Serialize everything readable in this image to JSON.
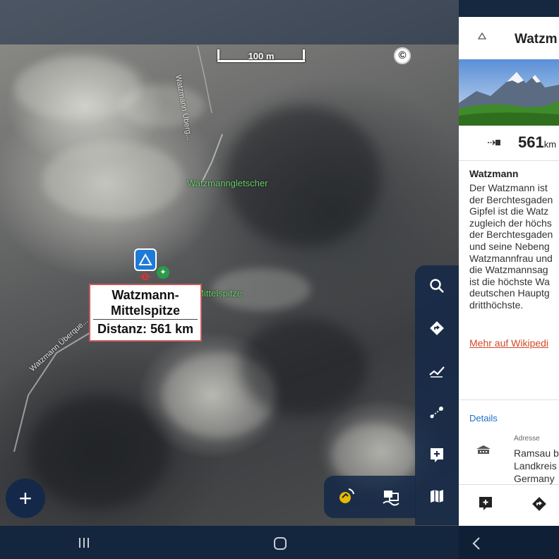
{
  "map": {
    "scale_label": "100 m",
    "copyright_symbol": "©",
    "labels": {
      "glacier": "Watzmanngletscher",
      "peak_partial": "en Mittelspitze",
      "road_top": "Watzmann Überg...",
      "road_left": "Watzmann Überque..."
    },
    "callout": {
      "name_line1": "Watzmann-",
      "name_line2": "Mittelspitze",
      "distance": "Distanz: 561 km"
    },
    "toolbar": [
      "search-icon",
      "directions-icon",
      "track-icon",
      "route-planner-icon",
      "add-note-icon",
      "map-icon"
    ],
    "bottom_toolbar": [
      "gps-icon",
      "map-layers-icon"
    ],
    "fab_label": "+"
  },
  "panel": {
    "title": "Watzm",
    "distance_value": "561",
    "distance_unit": "km",
    "desc_title": "Watzmann",
    "desc_text": "Der Watzmann ist\nder Berchtesgaden\nGipfel ist die Watz\nzugleich der höchs\nder Berchtesgaden\nund seine Nebeng\nWatzmannfrau und\ndie Watzmannsag\nist die höchste Wa\ndeutschen Hauptg\ndritthöchste.",
    "wiki_link": "Mehr auf Wikipedi",
    "details_label": "Details",
    "address_label": "Adresse",
    "address_text": "Ramsau b\nLandkreis\nGermany"
  },
  "colors": {
    "primary_dark": "#14284a",
    "accent_blue": "#1e7ad8",
    "link": "#d04a2a",
    "label_green": "#6ad06a"
  }
}
